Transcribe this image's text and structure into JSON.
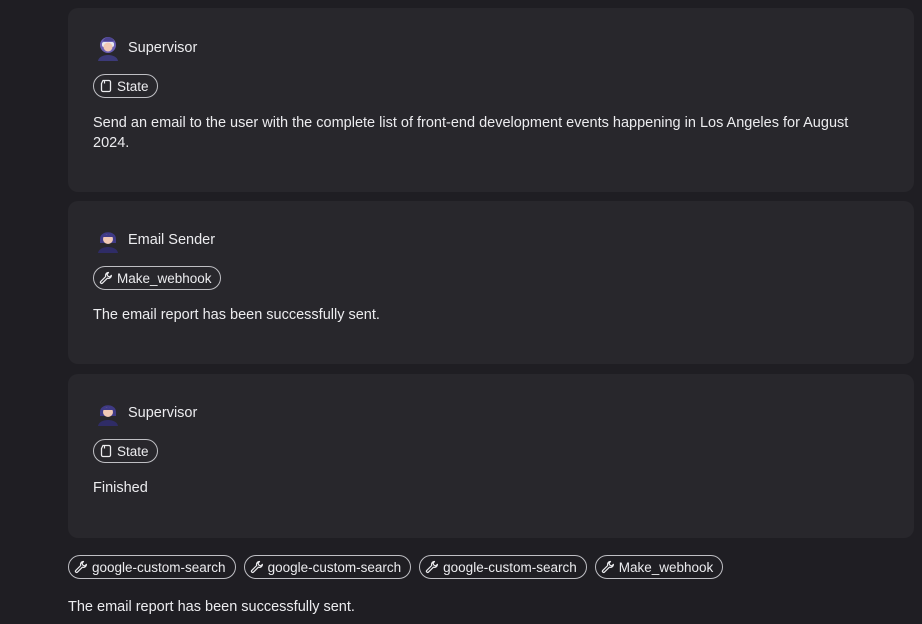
{
  "messages": [
    {
      "agent": "Supervisor",
      "avatar_icon": "supervisor-avatar-icon",
      "tool": {
        "label": "State",
        "icon": "document-icon"
      },
      "text": "Send an email to the user with the complete list of front-end development events happening in Los Angeles for August 2024."
    },
    {
      "agent": "Email Sender",
      "avatar_icon": "email-sender-avatar-icon",
      "tool": {
        "label": "Make_webhook",
        "icon": "wrench-icon"
      },
      "text": "The email report has been successfully sent."
    },
    {
      "agent": "Supervisor",
      "avatar_icon": "supervisor-avatar-icon",
      "tool": {
        "label": "State",
        "icon": "document-icon"
      },
      "text": "Finished"
    }
  ],
  "tools_used": [
    {
      "label": "google-custom-search",
      "icon": "wrench-icon"
    },
    {
      "label": "google-custom-search",
      "icon": "wrench-icon"
    },
    {
      "label": "google-custom-search",
      "icon": "wrench-icon"
    },
    {
      "label": "Make_webhook",
      "icon": "wrench-icon"
    }
  ],
  "final_response": "The email report has been successfully sent.",
  "colors": {
    "background": "#1f1e23",
    "card": "#28272c",
    "text": "#ececef",
    "pill_border": "#bfbfc4"
  }
}
